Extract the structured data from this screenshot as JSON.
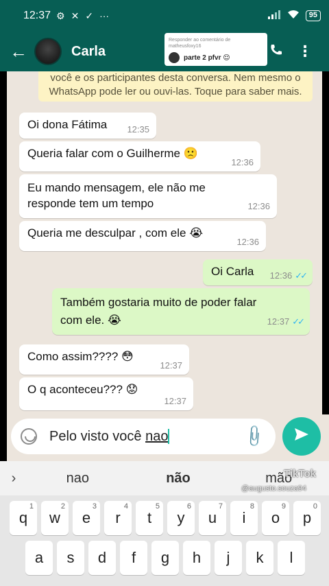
{
  "status_bar": {
    "time": "12:37",
    "battery": "95"
  },
  "header": {
    "contact_name": "Carla"
  },
  "sticker": {
    "caption": "Responder ao comentário de",
    "user": "matheusfoxy16",
    "reply": "parte 2 pfvr 😌"
  },
  "notice": {
    "text": "você e os participantes desta conversa. Nem mesmo o WhatsApp pode ler ou ouvi-las. Toque para saber mais."
  },
  "messages": [
    {
      "direction": "in",
      "text": "Oi dona Fátima",
      "time": "12:35"
    },
    {
      "direction": "in",
      "text": "Queria falar com o Guilherme 🙁",
      "time": "12:36"
    },
    {
      "direction": "in",
      "text": "Eu mando mensagem,  ele não me responde tem um tempo",
      "time": "12:36"
    },
    {
      "direction": "in",
      "text": "Queria me desculpar , com ele 😭",
      "time": "12:36"
    },
    {
      "direction": "out",
      "text": "Oi Carla",
      "time": "12:36"
    },
    {
      "direction": "out",
      "text": "Também gostaria muito de poder falar com ele. 😭",
      "time": "12:37"
    },
    {
      "direction": "in",
      "text": "Como assim???? 😳",
      "time": "12:37"
    },
    {
      "direction": "in",
      "text": "O q aconteceu??? 😟",
      "time": "12:37"
    }
  ],
  "composer": {
    "text_prefix": "Pelo visto você ",
    "text_underlined": "nao"
  },
  "suggestions": [
    "nao",
    "não",
    "mão"
  ],
  "watermark": {
    "brand": "TikTok",
    "handle": "@augusto.souza94"
  },
  "keyboard": {
    "row1": [
      {
        "key": "q",
        "num": "1"
      },
      {
        "key": "w",
        "num": "2"
      },
      {
        "key": "e",
        "num": "3"
      },
      {
        "key": "r",
        "num": "4"
      },
      {
        "key": "t",
        "num": "5"
      },
      {
        "key": "y",
        "num": "6"
      },
      {
        "key": "u",
        "num": "7"
      },
      {
        "key": "i",
        "num": "8"
      },
      {
        "key": "o",
        "num": "9"
      },
      {
        "key": "p",
        "num": "0"
      }
    ],
    "row2": [
      "a",
      "s",
      "d",
      "f",
      "g",
      "h",
      "j",
      "k",
      "l"
    ]
  },
  "colors": {
    "header": "#075e54",
    "bubble_in": "#ffffff",
    "bubble_out": "#dcf8c6",
    "chat_bg": "#ece5dd",
    "send": "#1ebea5",
    "ticks": "#34b7f1"
  }
}
